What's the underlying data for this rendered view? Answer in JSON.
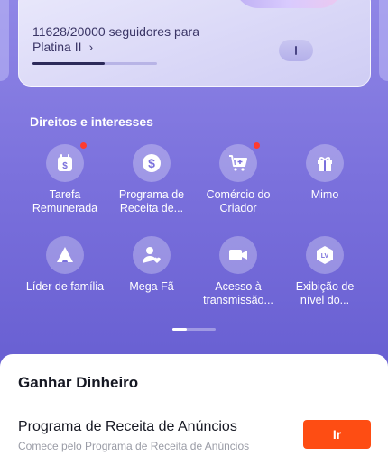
{
  "level_card": {
    "progress_text": "11628/20000 seguidores para",
    "next_level": "Platina II",
    "chevron": "›",
    "progress_fraction": 0.58
  },
  "rights": {
    "title": "Direitos e interesses",
    "items": [
      {
        "label": "Tarefa Remunerada",
        "icon": "calendar-dollar-icon",
        "dot": true
      },
      {
        "label": "Programa de Receita de...",
        "icon": "dollar-coin-icon",
        "dot": false
      },
      {
        "label": "Comércio do Criador",
        "icon": "cart-plus-icon",
        "dot": true
      },
      {
        "label": "Mimo",
        "icon": "gift-icon",
        "dot": false
      },
      {
        "label": "Líder de família",
        "icon": "family-tent-icon",
        "dot": false
      },
      {
        "label": "Mega Fã",
        "icon": "user-heart-icon",
        "dot": false
      },
      {
        "label": "Acesso à transmissão...",
        "icon": "video-camera-icon",
        "dot": false
      },
      {
        "label": "Exibição de nível do...",
        "icon": "level-badge-icon",
        "dot": false
      }
    ]
  },
  "earn": {
    "title": "Ganhar Dinheiro",
    "offer_title": "Programa de Receita de Anúncios",
    "offer_subtitle": "Comece pelo Programa de Receita de Anúncios",
    "button_label": "Ir",
    "button_color": "#fe4d13"
  }
}
